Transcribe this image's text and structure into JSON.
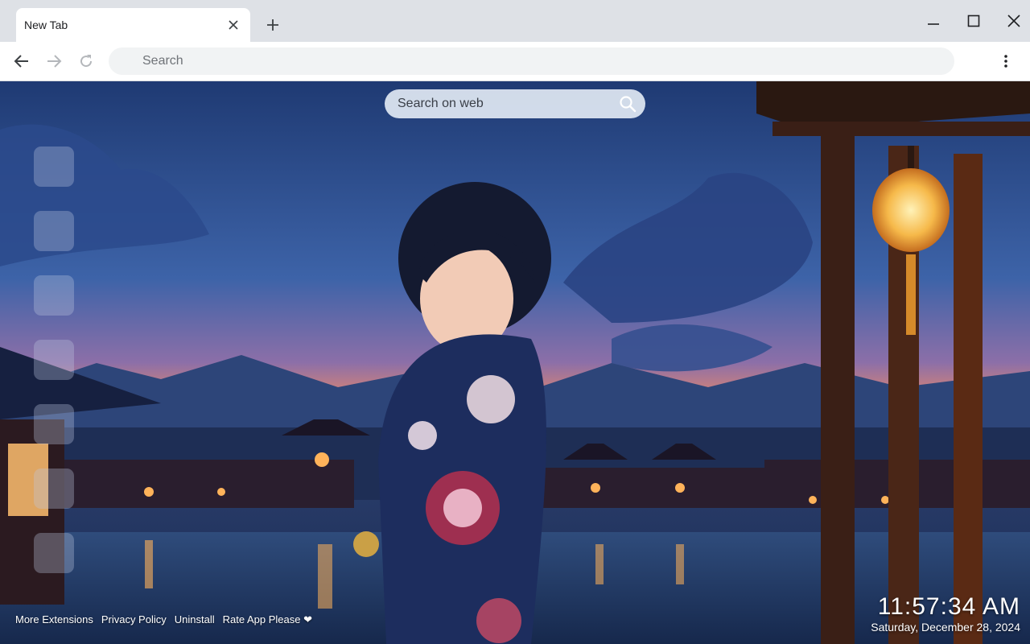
{
  "browser": {
    "tab_title": "New Tab",
    "omnibox_placeholder": "Search",
    "icons": [
      "close-icon",
      "plus-icon",
      "minimize-icon",
      "maximize-icon",
      "window-close-icon",
      "back-arrow-icon",
      "forward-arrow-icon",
      "reload-icon",
      "kebab-menu-icon"
    ]
  },
  "page": {
    "search_placeholder": "Search on web",
    "search_icon": "magnifier-icon",
    "shortcut_count": 7,
    "footer_links": [
      {
        "label": "More Extensions"
      },
      {
        "label": "Privacy Policy"
      },
      {
        "label": "Uninstall"
      },
      {
        "label": "Rate App Please ❤"
      }
    ],
    "clock": {
      "time": "11:57:34 AM",
      "date": "Saturday, December 28, 2024"
    }
  },
  "colors": {
    "tabstrip": "#dee1e6",
    "toolbar": "#ffffff",
    "omnibox": "#f1f3f4",
    "sky_top": "#1f3a73",
    "sky_horizon": "#f08a64"
  }
}
